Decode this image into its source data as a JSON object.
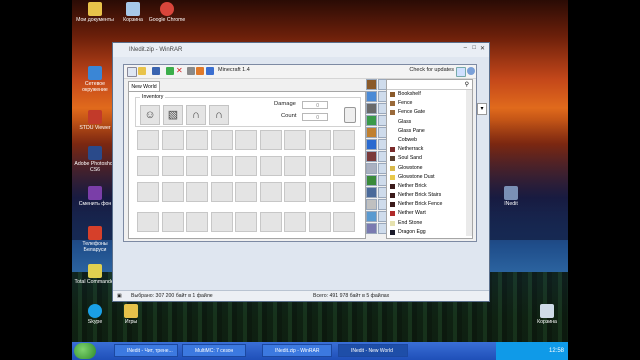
{
  "desktop": {
    "icons": [
      {
        "label": "Мои документы",
        "color": "#e8c34a"
      },
      {
        "label": "Корзина",
        "color": "#a7c8e8"
      },
      {
        "label": "Google Chrome",
        "color": "#d9453b"
      },
      {
        "label": "Сетевое окружение",
        "color": "#3a86d6"
      },
      {
        "label": "STDU Viewer",
        "color": "#c23a2a"
      },
      {
        "label": "Adobe Photoshop CS6",
        "color": "#2a4a8a"
      },
      {
        "label": "Сменить фон",
        "color": "#7a3ea8"
      },
      {
        "label": "Телефоны Беларуси",
        "color": "#d6402a"
      },
      {
        "label": "Total Commander",
        "color": "#e0d050"
      },
      {
        "label": "Skype",
        "color": "#1aa0e6"
      },
      {
        "label": "Игры",
        "color": "#e6c24a"
      },
      {
        "label": "INedit",
        "color": "#7a90b6"
      },
      {
        "label": "Корзина",
        "color": "#cfdbe8"
      }
    ]
  },
  "winrar": {
    "title": "INedit.zip - WinRAR",
    "status_left": "Выбрано: 307 200 байт в 1 файле",
    "status_right": "Всего: 491 978 байт в 5 файлах"
  },
  "inedit": {
    "title": "INedit - New World",
    "version": "Minecraft 1.4",
    "check_updates": "Check for updates",
    "tab": "New World",
    "inventory_title": "Inventory",
    "damage_label": "Damage",
    "count_label": "Count",
    "damage_value": "0",
    "count_value": "0",
    "armor_icons": [
      "helmet-icon",
      "chestplate-icon",
      "leggings-icon",
      "boots-icon"
    ],
    "items": [
      {
        "name": "Bookshelf",
        "color": "#8a5a2a"
      },
      {
        "name": "Fence",
        "color": "#9a6a3a"
      },
      {
        "name": "Fence Gate",
        "color": "#9a6a3a"
      },
      {
        "name": "Glass",
        "color": "#ffffff"
      },
      {
        "name": "Glass Pane",
        "color": "#ffffff"
      },
      {
        "name": "Cobweb",
        "color": "#ffffff"
      },
      {
        "name": "Netherrack",
        "color": "#7a2a2a"
      },
      {
        "name": "Soul Sand",
        "color": "#5a4030"
      },
      {
        "name": "Glowstone",
        "color": "#d8b84a"
      },
      {
        "name": "Glowstone Dust",
        "color": "#e8c84a"
      },
      {
        "name": "Nether Brick",
        "color": "#3a1a1a"
      },
      {
        "name": "Nether Brick Stairs",
        "color": "#3a1a1a"
      },
      {
        "name": "Nether Brick Fence",
        "color": "#3a1a1a"
      },
      {
        "name": "Nether Wart",
        "color": "#b02a2a"
      },
      {
        "name": "End Stone",
        "color": "#e6e2b0"
      },
      {
        "name": "Dragon Egg",
        "color": "#1a1a2a"
      }
    ]
  },
  "taskbar": {
    "buttons": [
      "INedit - Чит, трене...",
      "MultiMC: 7 сезон",
      "INedit.zip - WinRAR",
      "INedit - New World"
    ],
    "clock": "12:58"
  }
}
